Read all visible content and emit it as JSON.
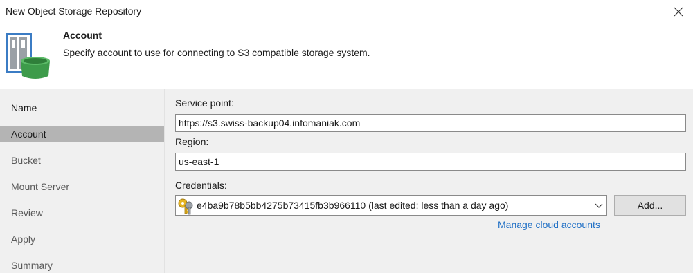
{
  "window": {
    "title": "New Object Storage Repository",
    "close_icon": "close-icon"
  },
  "header": {
    "title": "Account",
    "description": "Specify account to use for connecting to S3 compatible storage system.",
    "icon": "object-storage-bucket-icon"
  },
  "sidebar": {
    "items": [
      {
        "label": "Name",
        "active": false
      },
      {
        "label": "Account",
        "active": true
      },
      {
        "label": "Bucket",
        "active": false
      },
      {
        "label": "Mount Server",
        "active": false
      },
      {
        "label": "Review",
        "active": false
      },
      {
        "label": "Apply",
        "active": false
      },
      {
        "label": "Summary",
        "active": false
      }
    ]
  },
  "form": {
    "service_point_label": "Service point:",
    "service_point_value": "https://s3.swiss-backup04.infomaniak.com",
    "region_label": "Region:",
    "region_value": "us-east-1",
    "credentials_label": "Credentials:",
    "credentials_value": "e4ba9b78b5bb4275b73415fb3b966110 (last edited: less than a day ago)",
    "credentials_icon": "key-icon",
    "add_button": "Add...",
    "manage_link": "Manage cloud accounts"
  },
  "colors": {
    "accent_link": "#1f6fc5",
    "active_item": "#b4b4b4",
    "panel_bg": "#f0f0f0"
  }
}
